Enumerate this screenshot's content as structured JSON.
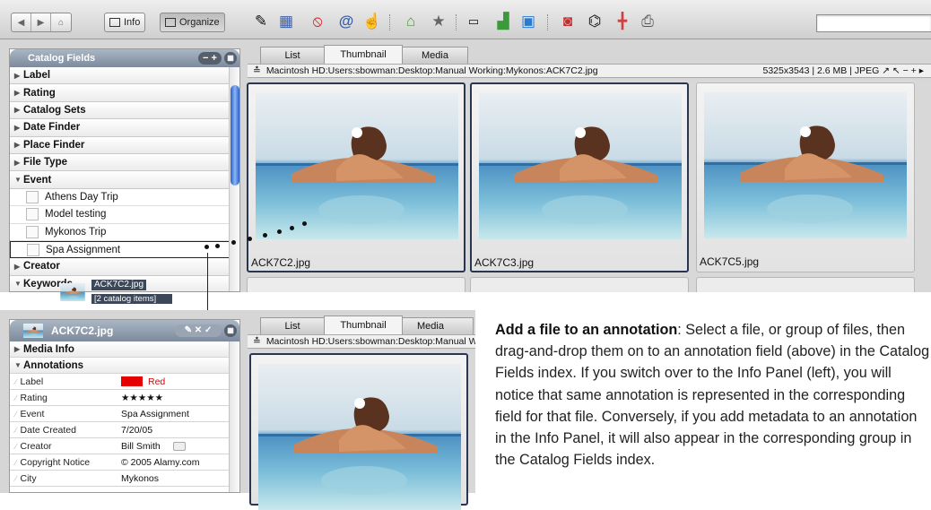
{
  "toolbar": {
    "nav": [
      "◀",
      "▶",
      "⌂"
    ],
    "info_label": "Info",
    "organize_label": "Organize",
    "icons": [
      "pencil-icon",
      "film-icon",
      "no-entry-icon",
      "at-icon",
      "hand-icon",
      "bag-icon",
      "star-icon",
      "text-field-icon",
      "chart-icon",
      "photo-icon",
      "stop-icon",
      "glasses-icon",
      "adjust-icon",
      "printer-icon"
    ]
  },
  "catalog": {
    "header": "Catalog Fields",
    "header_controls": "− +",
    "fields": [
      "Label",
      "Rating",
      "Catalog Sets",
      "Date Finder",
      "Place Finder",
      "File Type"
    ],
    "event": {
      "label": "Event",
      "items": [
        "Athens Day Trip",
        "Model testing",
        "Mykonos Trip",
        "Spa Assignment"
      ]
    },
    "after": [
      "Creator",
      "Keywords"
    ]
  },
  "drag": {
    "filename": "ACK7C2.jpg",
    "count": "[2 catalog items]"
  },
  "browser": {
    "tabs": [
      "List",
      "Thumbnail",
      "Media"
    ],
    "selected_tab": "Thumbnail",
    "path": "Macintosh HD:Users:sbowman:Desktop:Manual Working:Mykonos:ACK7C2.jpg",
    "path_short": "Macintosh HD:Users:sbowman:Desktop:Manual Working:Mykonos:ACK7C2.jpg",
    "file_info": "5325x3543 | 2.6 MB | JPEG ↗ ↖ − + ▸",
    "thumbnails": [
      {
        "name": "ACK7C2.jpg",
        "selected": true
      },
      {
        "name": "ACK7C3.jpg",
        "selected": true
      },
      {
        "name": "ACK7C5.jpg",
        "selected": false
      }
    ]
  },
  "info_panel": {
    "title": "ACK7C2.jpg",
    "media_info": "Media Info",
    "annotations": "Annotations",
    "rows": [
      {
        "key": "Label",
        "value": "Red"
      },
      {
        "key": "Rating",
        "value": "★★★★★"
      },
      {
        "key": "Event",
        "value": "Spa Assignment"
      },
      {
        "key": "Date Created",
        "value": "7/20/05"
      },
      {
        "key": "Creator",
        "value": "Bill Smith"
      },
      {
        "key": "Copyright Notice",
        "value": "© 2005 Alamy.com"
      },
      {
        "key": "City",
        "value": "Mykonos"
      }
    ],
    "label_color": "#e40000"
  },
  "browser2": {
    "tabs": [
      "List",
      "Thumbnail",
      "Media"
    ]
  },
  "callout": {
    "heading": "Add a file to an annotation",
    "body": ": Select a file, or group of files, then drag-and-drop them on to an annotation field (above) in the Catalog Fields index. If you switch over to the Info Panel (left), you will notice that same annotation is represented in the corresponding field for that file. Conversely, if you add metadata to an annotation in the Info Panel, it will also appear in the corresponding group in the Catalog Fields index."
  }
}
